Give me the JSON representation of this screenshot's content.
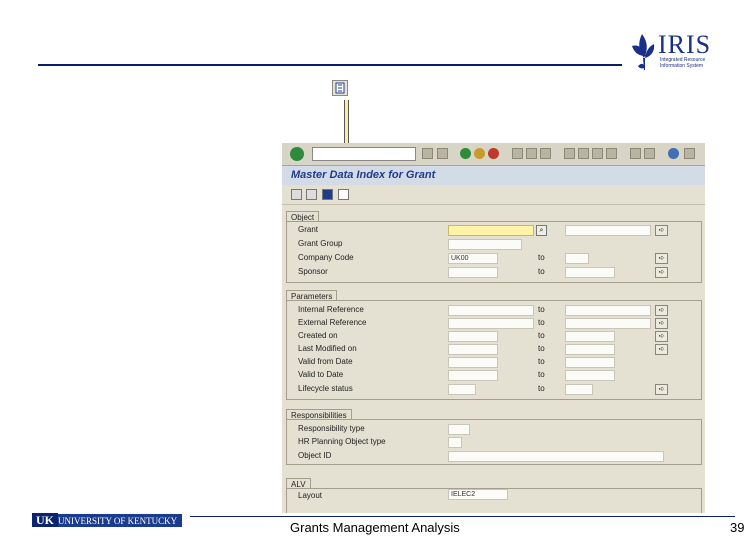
{
  "slide": {
    "brand_name": "IRIS",
    "brand_tagline": "Integrated Resource Information System",
    "university": "UNIVERSITY OF KENTUCKY",
    "university_mark": "UK",
    "footer_title": "Grants Management Analysis",
    "page_number": "39"
  },
  "sap": {
    "title": "Master Data Index for Grant",
    "groups": {
      "object": "Object",
      "parameters": "Parameters",
      "responsibilities": "Responsibilities",
      "alv": "ALV"
    },
    "object_fields": [
      {
        "label": "Grant",
        "value": ""
      },
      {
        "label": "Grant Group",
        "value": ""
      },
      {
        "label": "Company Code",
        "value": "UK00"
      },
      {
        "label": "Sponsor",
        "value": ""
      }
    ],
    "parameter_fields": [
      {
        "label": "Internal Reference"
      },
      {
        "label": "External Reference"
      },
      {
        "label": "Created on"
      },
      {
        "label": "Last Modified on"
      },
      {
        "label": "Valid from Date"
      },
      {
        "label": "Valid to Date"
      },
      {
        "label": "Lifecycle status"
      }
    ],
    "responsibility_fields": [
      {
        "label": "Responsibility type"
      },
      {
        "label": "HR Planning Object type"
      },
      {
        "label": "Object ID"
      }
    ],
    "alv": {
      "label": "Layout",
      "value": "IELEC2"
    },
    "to_label": "to"
  },
  "colors": {
    "brand_blue": "#1a2f88",
    "rule_blue": "#0b1f66",
    "sap_background": "#e4e0d2",
    "required_field": "#fff3a8",
    "callout_line": "#f7ef9a"
  }
}
